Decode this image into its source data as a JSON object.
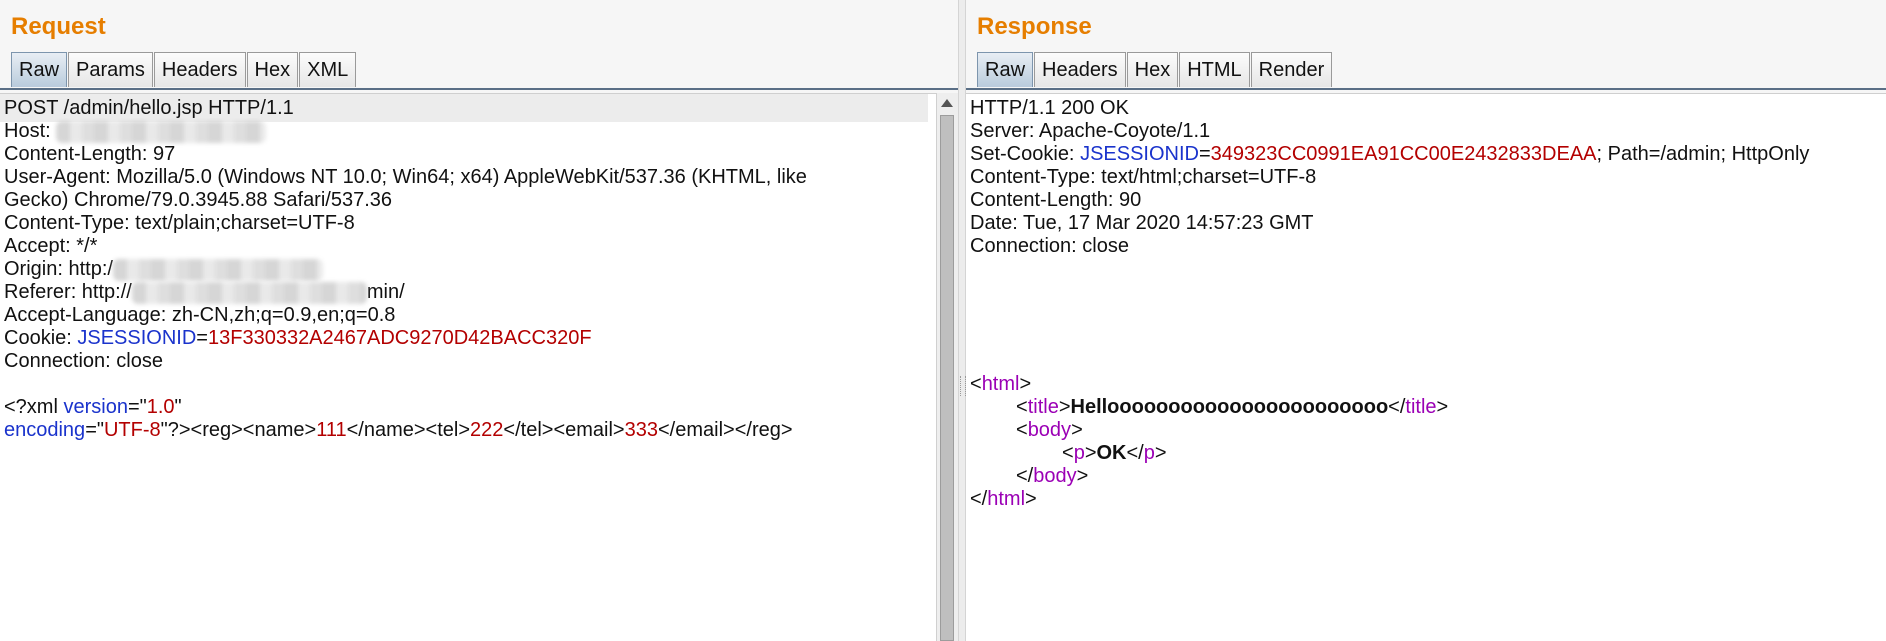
{
  "request": {
    "title": "Request",
    "tabs": [
      "Raw",
      "Params",
      "Headers",
      "Hex",
      "XML"
    ],
    "active_tab": "Raw",
    "lines": {
      "l1": "POST /admin/hello.jsp HTTP/1.1",
      "l2_label": "Host: ",
      "l3": "Content-Length: 97",
      "l4": "User-Agent: Mozilla/5.0 (Windows NT 10.0; Win64; x64) AppleWebKit/537.36 (KHTML, like",
      "l5": "Gecko) Chrome/79.0.3945.88 Safari/537.36",
      "l6": "Content-Type: text/plain;charset=UTF-8",
      "l7": "Accept: */*",
      "l8_label": "Origin: http:/",
      "l9_label": "Referer: http://",
      "l9_tail": "min/",
      "l10": "Accept-Language: zh-CN,zh;q=0.9,en;q=0.8",
      "l11_label": "Cookie: ",
      "l11_key": "JSESSIONID",
      "l11_eq": "=",
      "l11_val": "13F330332A2467ADC9270D42BACC320F",
      "l12": "Connection: close",
      "x1_open": "<?xml ",
      "x1_attr": "version",
      "x1_eq": "=\"",
      "x1_val": "1.0",
      "x1_close": "\"",
      "x2_attr": "encoding",
      "x2_eq": "=\"",
      "x2_val": "UTF-8",
      "x2_mid": "\"?><reg><name>",
      "x2_name": "111",
      "x2_tel_open": "</name><tel>",
      "x2_tel": "222",
      "x2_email_open": "</tel><email>",
      "x2_email": "333",
      "x2_end": "</email></reg>"
    }
  },
  "response": {
    "title": "Response",
    "tabs": [
      "Raw",
      "Headers",
      "Hex",
      "HTML",
      "Render"
    ],
    "active_tab": "Raw",
    "lines": {
      "l1": "HTTP/1.1 200 OK",
      "l2": "Server: Apache-Coyote/1.1",
      "l3_label": "Set-Cookie: ",
      "l3_key": "JSESSIONID",
      "l3_eq": "=",
      "l3_val": "349323CC0991EA91CC00E2432833DEAA",
      "l3_tail": "; Path=/admin; HttpOnly",
      "l4": "Content-Type: text/html;charset=UTF-8",
      "l5": "Content-Length: 90",
      "l6": "Date: Tue, 17 Mar 2020 14:57:23 GMT",
      "l7": "Connection: close",
      "h_html": "html",
      "h_title": "title",
      "title_text": "Hellooooooooooooooooooooooo",
      "h_body": "body",
      "h_p": "p",
      "p_text": "OK",
      "lt": "<",
      "gt": ">",
      "lts": "</"
    }
  }
}
